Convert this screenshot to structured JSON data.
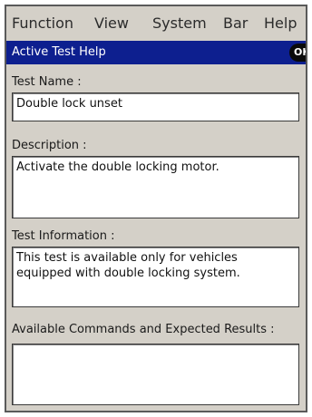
{
  "menu": {
    "items": [
      "Function",
      "View",
      "System",
      "Bar",
      "Help"
    ]
  },
  "titlebar": {
    "title": "Active Test Help",
    "ok_label": "OK"
  },
  "form": {
    "test_name_label": "Test Name :",
    "test_name_value": "Double lock unset",
    "description_label": "Description :",
    "description_value": "Activate the double locking motor.",
    "test_info_label": "Test Information :",
    "test_info_value": "This test is available only for vehicles equipped with double locking system.",
    "commands_label": "Available Commands and Expected Results :",
    "commands_value": ""
  },
  "colors": {
    "titlebar_bg": "#0d1f8f",
    "window_bg": "#d4d0c8",
    "field_bg": "#ffffff"
  }
}
